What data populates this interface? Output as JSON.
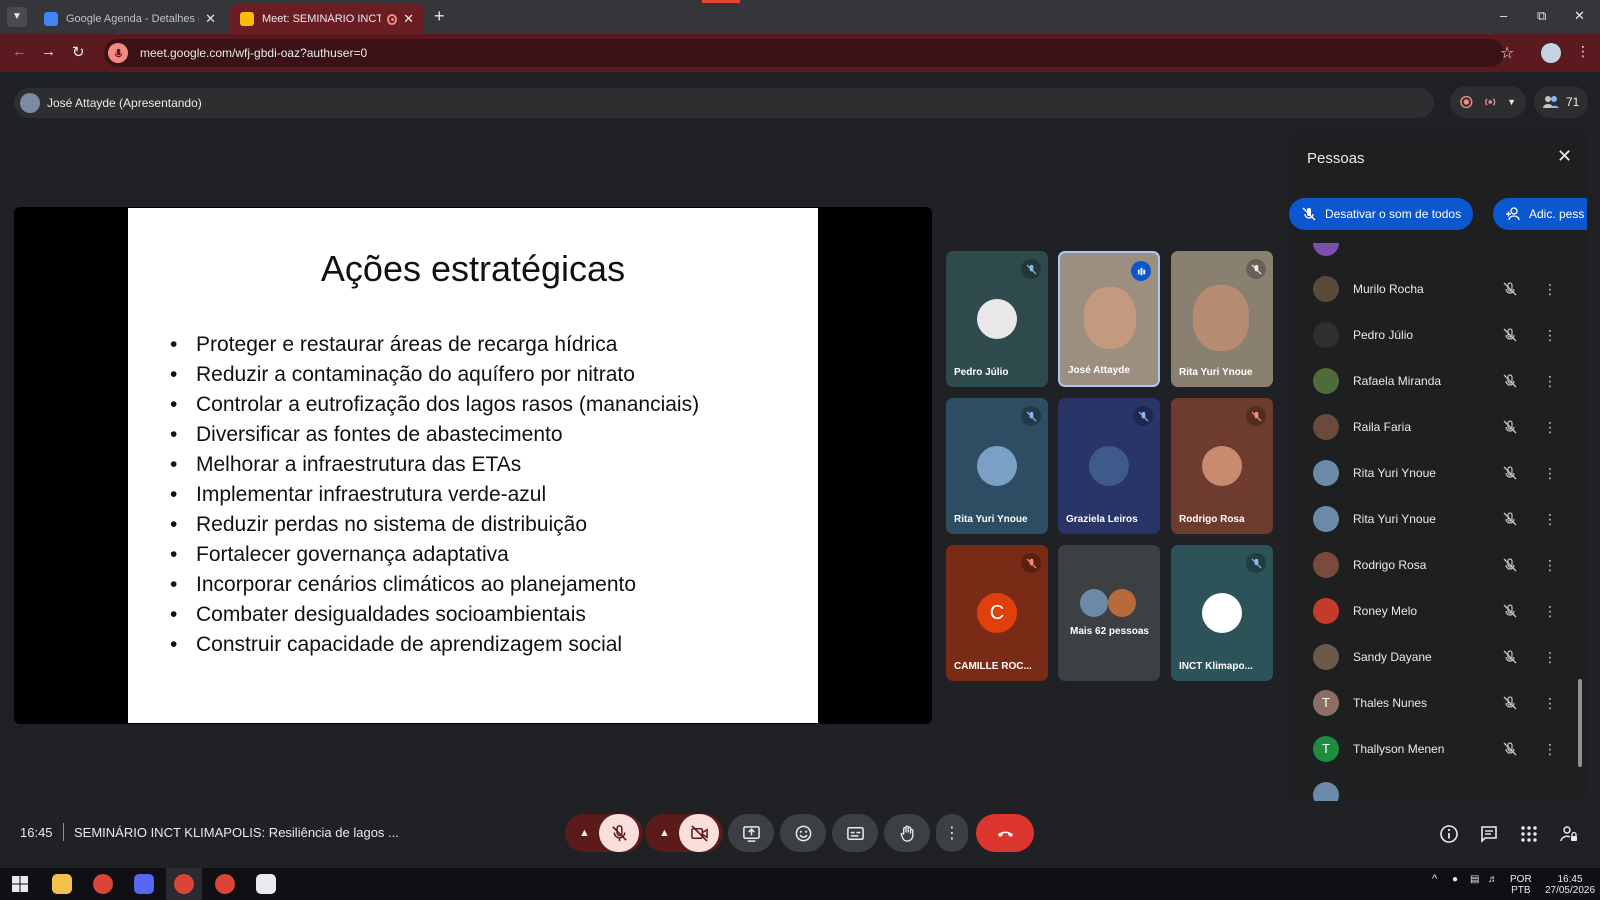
{
  "browser": {
    "tabs": [
      {
        "title": "Google Agenda - Detalhes do e",
        "favicon_color": "#4285f4"
      },
      {
        "title": "Meet: SEMINÁRIO INCT KLI",
        "favicon_color": "#fbbc04"
      }
    ],
    "url": "meet.google.com/wfj-gbdi-oaz?authuser=0"
  },
  "meet": {
    "presenter": "José Attayde (Apresentando)",
    "participant_count": "71",
    "slide": {
      "title": "Ações estratégicas",
      "bullets": [
        "Proteger e restaurar áreas de recarga hídrica",
        "Reduzir a contaminação do aquífero por nitrato",
        "Controlar a eutrofização dos lagos rasos (mananciais)",
        "Diversificar as fontes de abastecimento",
        "Melhorar a infraestrutura das ETAs",
        "Implementar infraestrutura verde-azul",
        "Reduzir perdas no sistema de distribuição",
        "Fortalecer governança adaptativa",
        "Incorporar cenários climáticos ao planejamento",
        "Combater desigualdades socioambientais",
        "Construir capacidade de aprendizagem social"
      ]
    },
    "tiles": [
      {
        "name": "Pedro Júlio",
        "bg": "#2f4a4d"
      },
      {
        "name": "José Attayde",
        "bg": "#9c8f7f"
      },
      {
        "name": "Rita Yuri Ynoue",
        "bg": "#8a8070"
      },
      {
        "name": "Rita Yuri Ynoue",
        "bg": "#2e4d63"
      },
      {
        "name": "Graziela Leiros",
        "bg": "#2a3567"
      },
      {
        "name": "Rodrigo Rosa",
        "bg": "#6e3c2e"
      },
      {
        "name": "CAMILLE ROC...",
        "bg": "#7a2b15",
        "initial": "C"
      },
      {
        "name": "Mais 62 pessoas",
        "bg": "#3c4043"
      },
      {
        "name": "INCT Klimapo...",
        "bg": "#2c5357"
      }
    ],
    "people_panel": {
      "title": "Pessoas",
      "mute_all": "Desativar o som de todos",
      "add_people": "Adic. pess",
      "people": [
        {
          "name": "Murilo Rocha",
          "color": "#5a4a3a"
        },
        {
          "name": "Pedro Júlio",
          "color": "#2f2f2f"
        },
        {
          "name": "Rafaela Miranda",
          "color": "#4f6b3a"
        },
        {
          "name": "Raila Faria",
          "color": "#6b4a3a"
        },
        {
          "name": "Rita Yuri Ynoue",
          "color": "#6b8aa8"
        },
        {
          "name": "Rita Yuri Ynoue",
          "color": "#6b8aa8"
        },
        {
          "name": "Rodrigo Rosa",
          "color": "#7a4a3a"
        },
        {
          "name": "Roney Melo",
          "color": "#c53a2a"
        },
        {
          "name": "Sandy Dayane",
          "color": "#6b5a4a"
        },
        {
          "name": "Thales Nunes",
          "color": "#8d6e63",
          "initial": "T"
        },
        {
          "name": "Thallyson Menen",
          "color": "#1e8e3e",
          "initial": "T"
        }
      ]
    },
    "bottom": {
      "time": "16:45",
      "meeting_title": "SEMINÁRIO INCT KLIMAPOLIS: Resiliência de lagos ..."
    }
  },
  "taskbar": {
    "lang_top": "POR",
    "lang_bottom": "PTB",
    "time": "16:45",
    "date": "27/05/2026"
  }
}
